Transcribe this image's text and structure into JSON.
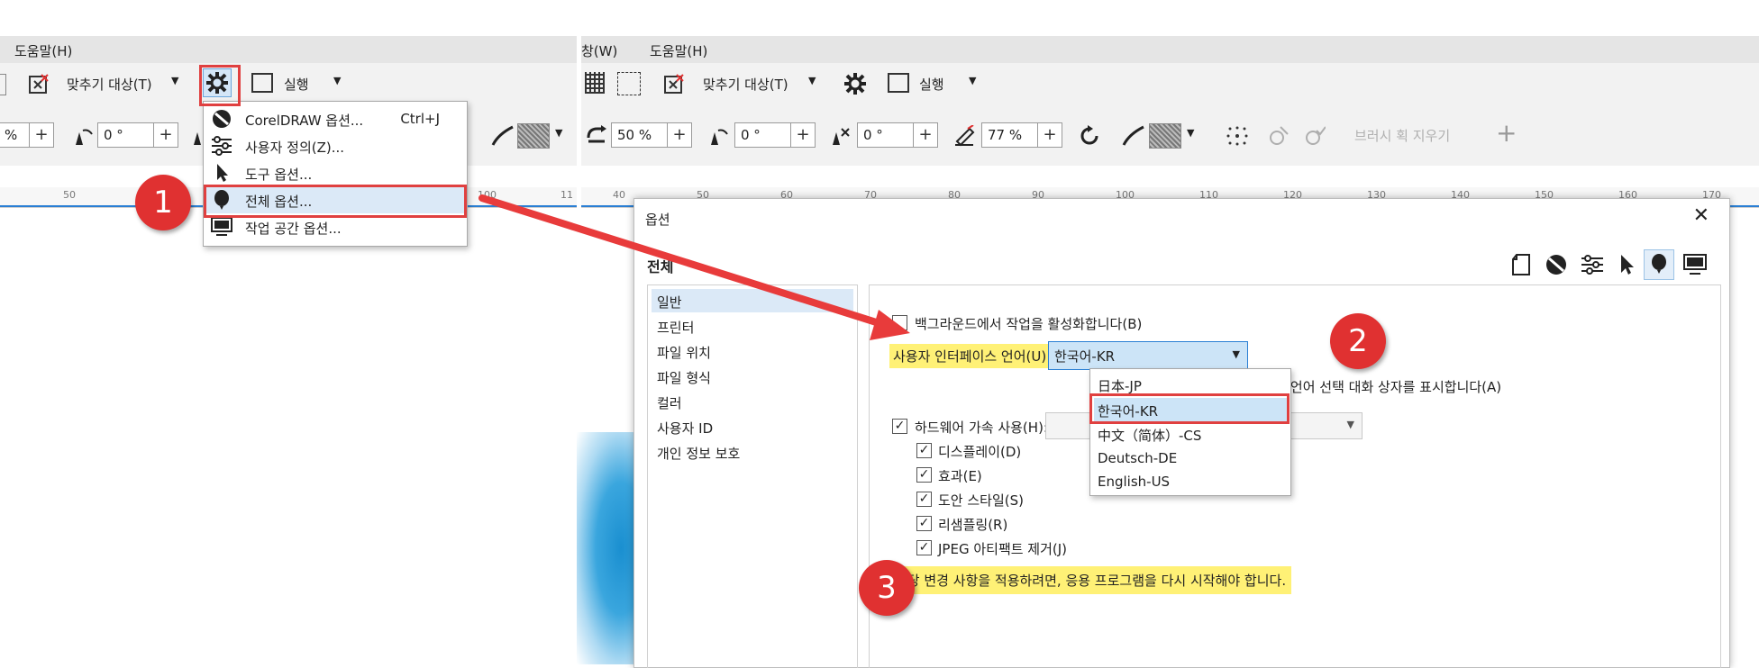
{
  "left_window": {
    "menu_help": "도움말(H)",
    "snap_label": "맞추기 대상(T)",
    "run_label": "실행",
    "spin_1": "%",
    "spin_2": "0 °"
  },
  "right_window": {
    "menu_window": "창(W)",
    "menu_help": "도움말(H)",
    "snap_label": "맞추기 대상(T)",
    "run_label": "실행",
    "spin_percent": "50 %",
    "spin_angle_1": "0 °",
    "spin_angle_2": "0 °",
    "spin_77": "77 %",
    "brush_erase": "브러시 획 지우기",
    "plus": "+"
  },
  "ruler_left": [
    "50",
    "100",
    "11"
  ],
  "ruler_right": [
    "40",
    "50",
    "60",
    "70",
    "80",
    "90",
    "100",
    "110",
    "120",
    "130",
    "140",
    "150",
    "160",
    "170"
  ],
  "gear_menu": {
    "items": [
      {
        "label": "CorelDRAW 옵션...",
        "shortcut": "Ctrl+J",
        "icon": "coreldraw-icon"
      },
      {
        "label": "사용자 정의(Z)...",
        "shortcut": "",
        "icon": "sliders-icon"
      },
      {
        "label": "도구 옵션...",
        "shortcut": "",
        "icon": "cursor-icon"
      },
      {
        "label": "전체 옵션...",
        "shortcut": "",
        "icon": "balloon-icon"
      },
      {
        "label": "작업 공간 옵션...",
        "shortcut": "",
        "icon": "monitor-icon"
      }
    ]
  },
  "dialog": {
    "title": "옵션",
    "close": "✕",
    "section": "전체",
    "sidebar": [
      "일반",
      "프린터",
      "파일 위치",
      "파일 형식",
      "컬러",
      "사용자 ID",
      "개인 정보 보호"
    ],
    "background_task": "백그라운드에서 작업을 활성화합니다(B)",
    "ui_language_label": "사용자 인터페이스 언어(U):",
    "ui_language_value": "한국어-KR",
    "show_language_dialog": "될 때, 언어 선택 대화 상자를 표시합니다(A)",
    "hw_accel": "하드웨어 가속 사용(H):",
    "hw_options": [
      "디스플레이(D)",
      "효과(E)",
      "도안 스타일(S)",
      "리샘플링(R)",
      "JPEG 아티팩트 제거(J)"
    ],
    "restart_note": "해당 변경 사항을 적용하려면, 응용 프로그램을 다시 시작해야 합니다.",
    "language_options": [
      "日本-JP",
      "한국어-KR",
      "中文（简体）-CS",
      "Deutsch-DE",
      "English-US"
    ]
  },
  "badges": [
    "1",
    "2",
    "3"
  ],
  "colors": {
    "accent": "#e03131",
    "highlight": "#fff176",
    "selection": "#cce4f7",
    "dropdown_border": "#2a7fd4"
  }
}
